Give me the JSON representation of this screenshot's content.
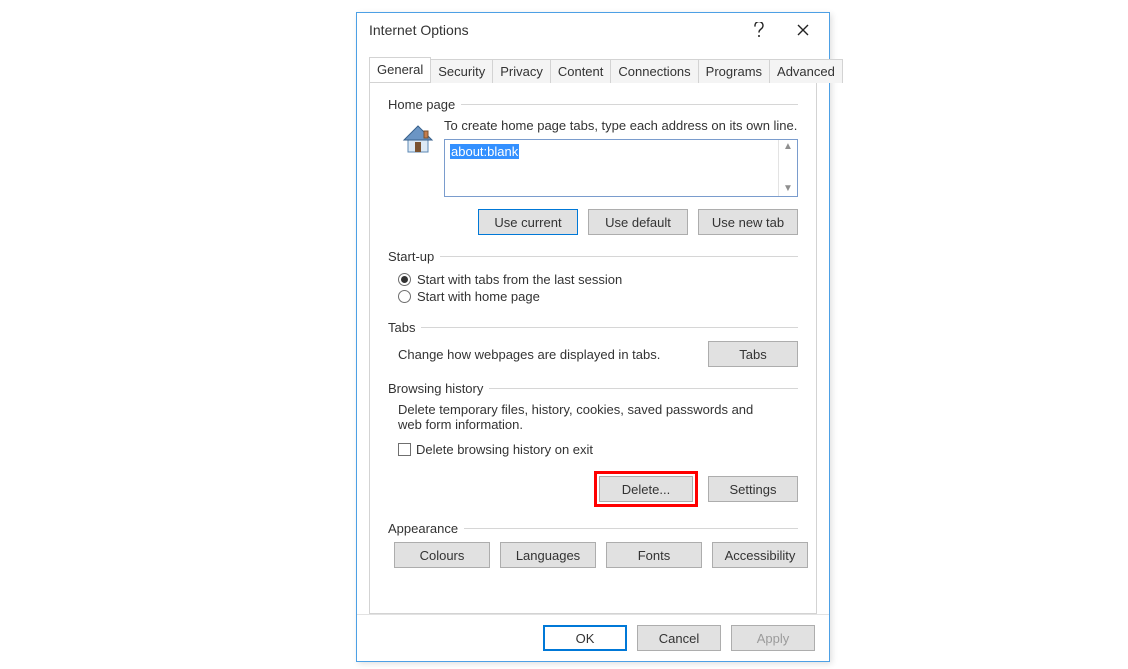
{
  "window": {
    "title": "Internet Options"
  },
  "tabs": {
    "items": [
      "General",
      "Security",
      "Privacy",
      "Content",
      "Connections",
      "Programs",
      "Advanced"
    ],
    "active": "General"
  },
  "home": {
    "group_label": "Home page",
    "intro": "To create home page tabs, type each address on its own line.",
    "value": "about:blank",
    "buttons": {
      "current": "Use current",
      "default": "Use default",
      "newtab": "Use new tab"
    }
  },
  "startup": {
    "group_label": "Start-up",
    "option_last_session": "Start with tabs from the last session",
    "option_home": "Start with home page",
    "selected": "last_session"
  },
  "tabs_section": {
    "group_label": "Tabs",
    "description": "Change how webpages are displayed in tabs.",
    "button": "Tabs"
  },
  "history": {
    "group_label": "Browsing history",
    "description": "Delete temporary files, history, cookies, saved passwords and web form information.",
    "checkbox_label": "Delete browsing history on exit",
    "buttons": {
      "delete": "Delete...",
      "settings": "Settings"
    }
  },
  "appearance": {
    "group_label": "Appearance",
    "buttons": {
      "colours": "Colours",
      "languages": "Languages",
      "fonts": "Fonts",
      "accessibility": "Accessibility"
    }
  },
  "footer": {
    "ok": "OK",
    "cancel": "Cancel",
    "apply": "Apply"
  }
}
